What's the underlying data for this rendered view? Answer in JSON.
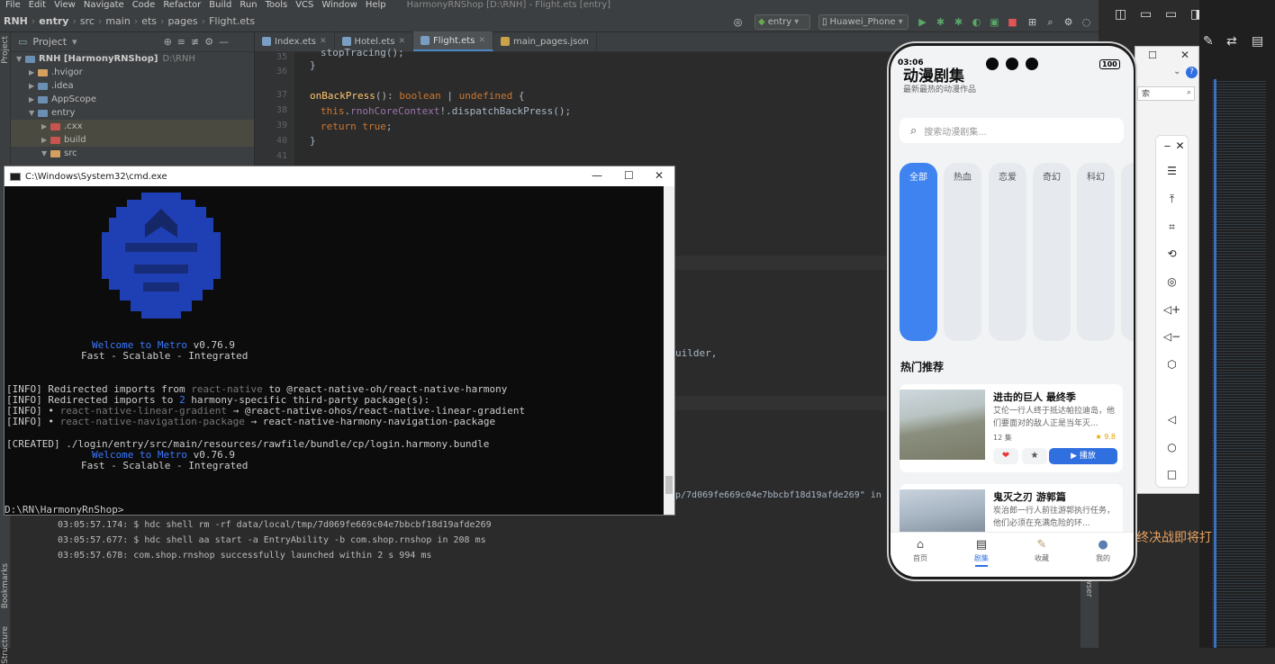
{
  "menu": {
    "items": [
      "File",
      "Edit",
      "View",
      "Navigate",
      "Code",
      "Refactor",
      "Build",
      "Run",
      "Tools",
      "VCS",
      "Window",
      "Help"
    ],
    "window_title": "HarmonyRNShop [D:\\RNH] - Flight.ets [entry]"
  },
  "navbar": {
    "crumbs": [
      "RNH",
      "entry",
      "src",
      "main",
      "ets",
      "pages",
      "Flight.ets"
    ],
    "run_config": "entry",
    "device": "Huawei_Phone"
  },
  "project": {
    "header": "Project",
    "tree": [
      {
        "label": "RNH [HarmonyRNShop]",
        "extra": "D:\\RNH",
        "indent": 0
      },
      {
        "label": ".hvigor",
        "indent": 1
      },
      {
        "label": ".idea",
        "indent": 1
      },
      {
        "label": "AppScope",
        "indent": 1
      },
      {
        "label": "entry",
        "indent": 1
      },
      {
        "label": ".cxx",
        "indent": 2
      },
      {
        "label": "build",
        "indent": 2
      },
      {
        "label": "src",
        "indent": 2
      }
    ]
  },
  "editor": {
    "tabs": [
      "Index.ets",
      "Hotel.ets",
      "Flight.ets",
      "main_pages.json"
    ],
    "active_tab": "Flight.ets",
    "line_numbers": [
      "35",
      "36",
      "37",
      "38",
      "39",
      "40",
      "41"
    ],
    "code": {
      "l35": "stopTracing();",
      "l35b": "}",
      "l37_a": "onBackPress",
      "l37_b": "(): ",
      "l37_c": "boolean",
      "l37_d": " | ",
      "l37_e": "undefined",
      "l37_f": " {",
      "l38_a": "this",
      "l38_b": ".",
      "l38_c": "rnohCoreContext",
      "l38_d": "!.dispatchBackPress();",
      "l39_a": "return ",
      "l39_b": "true",
      "l39_c": ";",
      "l40": "}",
      "builder": "uilder,",
      "hash_line": "p/7d069fe669c04e7bbcbf18d19afde269\" in"
    },
    "log": [
      "03:05:57.174: $ hdc shell rm -rf data/local/tmp/7d069fe669c04e7bbcbf18d19afde269",
      "03:05:57.677: $ hdc shell aa start -a EntryAbility -b com.shop.rnshop in 208 ms",
      "03:05:57.678: com.shop.rnshop successfully launched within 2 s 994 ms"
    ],
    "side_labels": {
      "bookmarks": "Bookmarks",
      "structure": "Structure",
      "project": "Project",
      "device_browser": "ce File Browser"
    }
  },
  "cmd": {
    "title": "C:\\Windows\\System32\\cmd.exe",
    "welcome_a": "Welcome to ",
    "welcome_b": "Metro",
    "welcome_c": " v0.76.9",
    "tagline": "Fast - Scalable - Integrated",
    "info1_a": "[INFO] Redirected imports from ",
    "info1_b": "react-native",
    "info1_c": " to @react-native-oh/react-native-harmony",
    "info2_a": "[INFO] Redirected imports to ",
    "info2_b": "2",
    "info2_c": " harmony-specific third-party package(s):",
    "info3_a": "[INFO] • ",
    "info3_b": "react-native-linear-gradient",
    "info3_c": " → @react-native-ohos/react-native-linear-gradient",
    "info4_a": "[INFO] • ",
    "info4_b": "react-native-navigation-package",
    "info4_c": " → react-native-harmony-navigation-package",
    "created": "[CREATED] ./login/entry/src/main/resources/rawfile/bundle/cp/login.harmony.bundle",
    "prompt": "D:\\RN\\HarmonyRnShop>"
  },
  "phone": {
    "time": "03:06",
    "battery": "100",
    "title": "动漫剧集",
    "subtitle": "最新最热的动漫作品",
    "search_placeholder": "搜索动漫剧集...",
    "categories": [
      "全部",
      "热血",
      "恋爱",
      "奇幻",
      "科幻"
    ],
    "section_title": "热门推荐",
    "cards": [
      {
        "title": "进击的巨人 最终季",
        "desc": "艾伦一行人终于抵达帕拉迪岛，他们要面对的敌人正是当年灭...",
        "episodes": "12 集",
        "rating": "9.8",
        "play": "播放"
      },
      {
        "title": "鬼灭之刃 游郭篇",
        "desc": "炭治郎一行人前往游郭执行任务，他们必须在充满危险的环..."
      }
    ],
    "tabs": [
      "首页",
      "剧集",
      "收藏",
      "我的"
    ],
    "active_tab": "剧集"
  },
  "emulator": {
    "search_hint": "索"
  },
  "right": {
    "orange_text": "终决战即将打"
  }
}
